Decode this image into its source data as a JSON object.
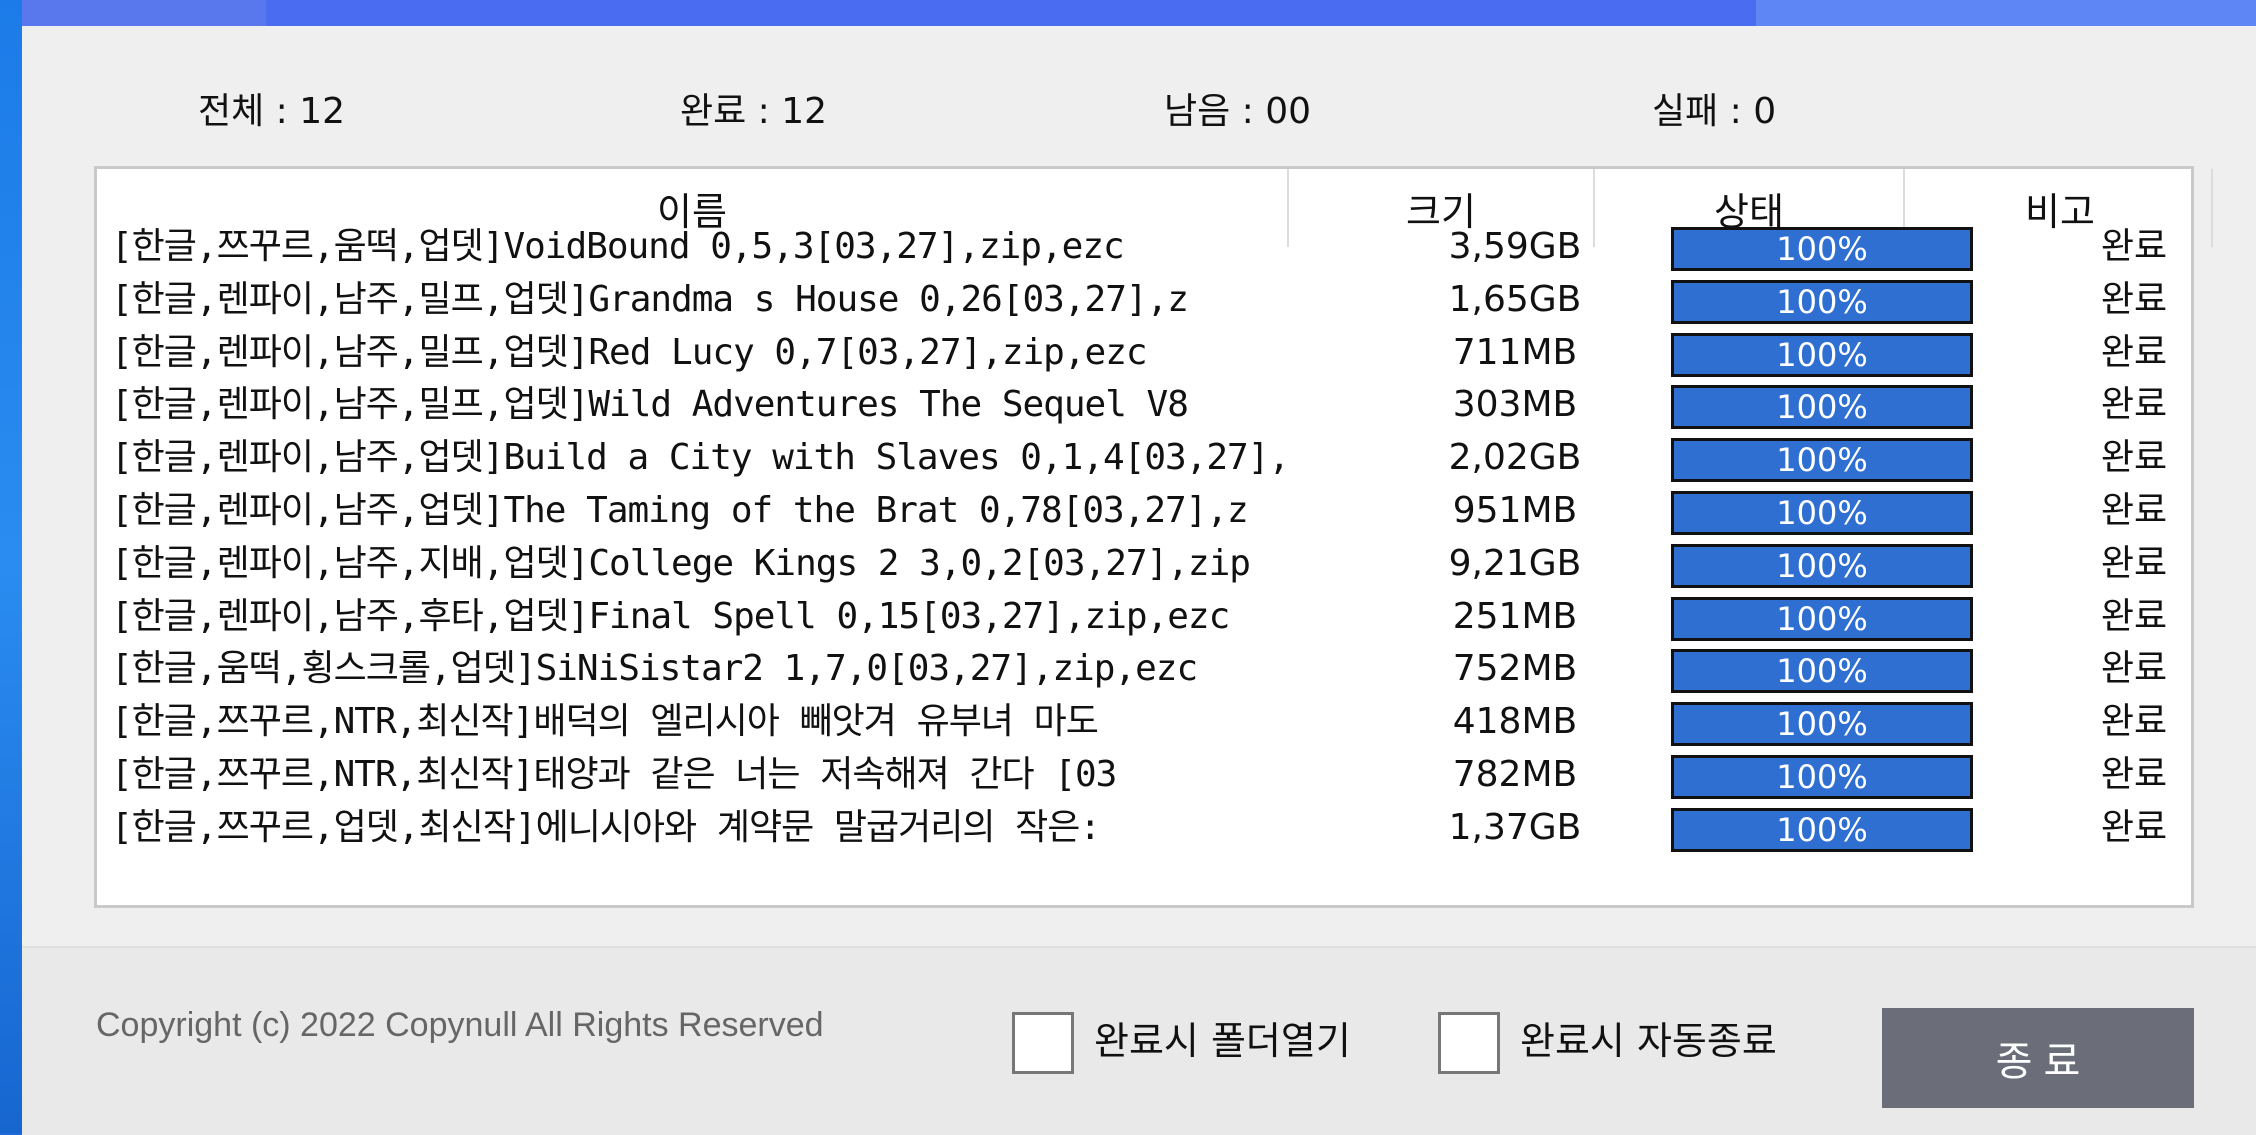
{
  "stats": {
    "total": "전체 : 12",
    "done": "완료 : 12",
    "remaining": "남음 : 00",
    "failed": "실패 : 0"
  },
  "table": {
    "headers": [
      "이름",
      "크기",
      "상태",
      "비고"
    ],
    "rows": [
      {
        "name": "[한글,쯔꾸르,움떡,업뎃]VoidBound 0,5,3[03,27],zip,ezc",
        "size": "3,59GB",
        "progress_pct": 100,
        "progress_label": "100%",
        "note": "완료"
      },
      {
        "name": "[한글,렌파이,남주,밀프,업뎃]Grandma s House 0,26[03,27],z",
        "size": "1,65GB",
        "progress_pct": 100,
        "progress_label": "100%",
        "note": "완료"
      },
      {
        "name": "[한글,렌파이,남주,밀프,업뎃]Red Lucy 0,7[03,27],zip,ezc",
        "size": "711MB",
        "progress_pct": 100,
        "progress_label": "100%",
        "note": "완료"
      },
      {
        "name": "[한글,렌파이,남주,밀프,업뎃]Wild Adventures The Sequel V8",
        "size": "303MB",
        "progress_pct": 100,
        "progress_label": "100%",
        "note": "완료"
      },
      {
        "name": "[한글,렌파이,남주,업뎃]Build a City with Slaves 0,1,4[03,27],",
        "size": "2,02GB",
        "progress_pct": 100,
        "progress_label": "100%",
        "note": "완료"
      },
      {
        "name": "[한글,렌파이,남주,업뎃]The Taming of the Brat 0,78[03,27],z",
        "size": "951MB",
        "progress_pct": 100,
        "progress_label": "100%",
        "note": "완료"
      },
      {
        "name": "[한글,렌파이,남주,지배,업뎃]College Kings 2 3,0,2[03,27],zip",
        "size": "9,21GB",
        "progress_pct": 100,
        "progress_label": "100%",
        "note": "완료"
      },
      {
        "name": "[한글,렌파이,남주,후타,업뎃]Final Spell 0,15[03,27],zip,ezc",
        "size": "251MB",
        "progress_pct": 100,
        "progress_label": "100%",
        "note": "완료"
      },
      {
        "name": "[한글,움떡,횡스크롤,업뎃]SiNiSistar2 1,7,0[03,27],zip,ezc",
        "size": "752MB",
        "progress_pct": 100,
        "progress_label": "100%",
        "note": "완료"
      },
      {
        "name": "[한글,쯔꾸르,NTR,최신작]배덕의 엘리시아 빼앗겨 유부녀 마도",
        "size": "418MB",
        "progress_pct": 100,
        "progress_label": "100%",
        "note": "완료"
      },
      {
        "name": "[한글,쯔꾸르,NTR,최신작]태양과 같은 너는 저속해져 간다 [03",
        "size": "782MB",
        "progress_pct": 100,
        "progress_label": "100%",
        "note": "완료"
      },
      {
        "name": "[한글,쯔꾸르,업뎃,최신작]에니시아와 계약문 말굽거리의 작은:",
        "size": "1,37GB",
        "progress_pct": 100,
        "progress_label": "100%",
        "note": "완료"
      }
    ]
  },
  "footer": {
    "copyright": "Copyright (c) 2022 Copynull All Rights Reserved",
    "open_folder_label": "완료시 폴더열기",
    "auto_exit_label": "완료시 자동종료",
    "quit_label": "종 료"
  },
  "colors": {
    "progress_fill": "#2e6fd1",
    "quit_button": "#6b6e78",
    "titlebar": "#4a6cf0"
  }
}
